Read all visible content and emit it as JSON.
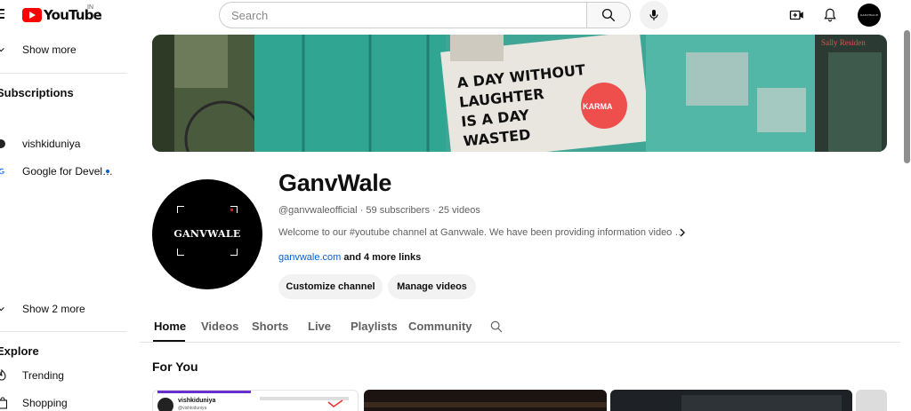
{
  "header": {
    "logo_text": "YouTube",
    "country": "IN",
    "search": {
      "placeholder": "Search",
      "value": ""
    },
    "account_avatar_text": "GANVWALE"
  },
  "sidebar": {
    "show_more": "Show more",
    "subscriptions_heading": "Subscriptions",
    "subscriptions": [
      {
        "label": "vishkiduniya"
      },
      {
        "label": "Google for Devel…",
        "new_content": true
      }
    ],
    "show_2_more": "Show 2 more",
    "explore_heading": "Explore",
    "explore_items": [
      {
        "label": "Trending",
        "icon": "trending-icon"
      },
      {
        "label": "Shopping",
        "icon": "shopping-bag-icon"
      }
    ]
  },
  "banner": {
    "sign_lines": [
      "A DAY WITHOUT",
      "LAUGHTER",
      "IS A DAY",
      "WASTED"
    ],
    "sticker_text": "KARMA",
    "shop_sign": "Sally Residen"
  },
  "channel": {
    "name": "GanvWale",
    "avatar_text": "GANVWALE",
    "handle": "@ganvwaleofficial",
    "subscribers": "59 subscribers",
    "videos": "25 videos",
    "description": "Welcome to our #youtube channel at Ganvwale. We have been providing information video …",
    "link": "ganvwale.com",
    "more_links": "and 4 more links",
    "customize_button": "Customize channel",
    "manage_button": "Manage videos"
  },
  "tabs": [
    "Home",
    "Videos",
    "Shorts",
    "Live",
    "Playlists",
    "Community"
  ],
  "active_tab": "Home",
  "section": {
    "title": "For You"
  },
  "thumbnails": [
    {
      "channel": "vishkiduniya",
      "handle": "@vishkiduniya"
    }
  ],
  "colors": {
    "brand_red": "#ff0000",
    "link_blue": "#065fd4",
    "text_primary": "#0f0f0f",
    "text_secondary": "#606060",
    "pill_bg": "#f2f2f2",
    "banner_wall": "#3fa696"
  }
}
